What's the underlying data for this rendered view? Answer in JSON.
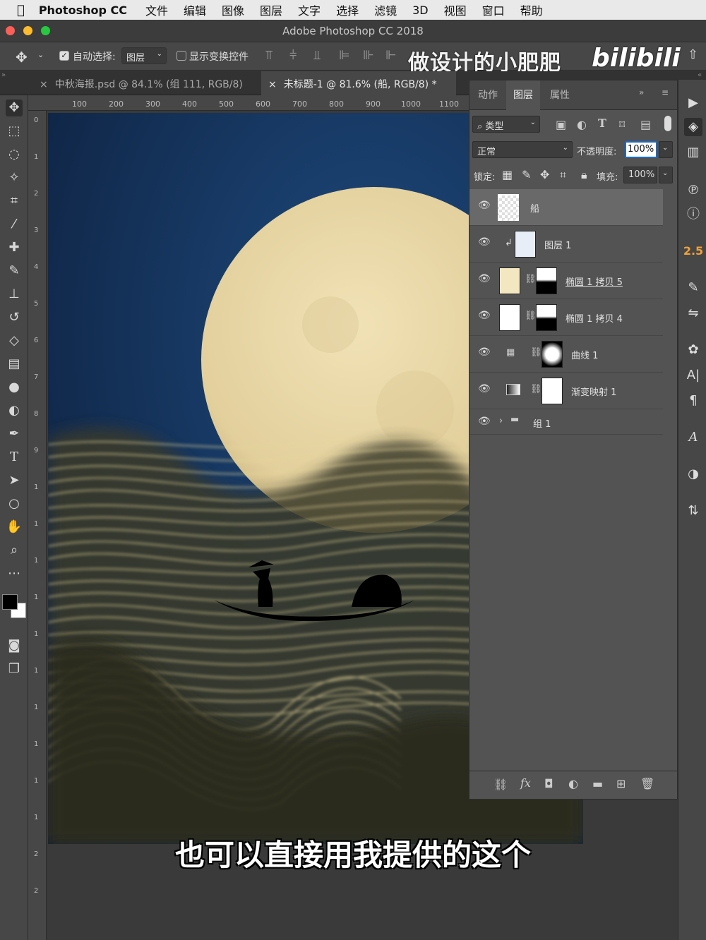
{
  "menubar": {
    "app": "Photoshop CC",
    "items": [
      "文件",
      "编辑",
      "图像",
      "图层",
      "文字",
      "选择",
      "滤镜",
      "3D",
      "视图",
      "窗口",
      "帮助"
    ]
  },
  "titlebar": {
    "title": "Adobe Photoshop CC 2018"
  },
  "options": {
    "auto_select_label": "自动选择:",
    "auto_select_value": "图层",
    "show_transform_label": "显示变换控件"
  },
  "watermark": {
    "text": "做设计的小肥肥",
    "brand": "bilibili"
  },
  "tabs": [
    {
      "label": "中秋海报.psd @ 84.1% (组 111, RGB/8)"
    },
    {
      "label": "未标题-1 @ 81.6% (船, RGB/8) *"
    }
  ],
  "ruler": {
    "top_ticks": [
      "100",
      "200",
      "300",
      "400",
      "500",
      "600",
      "700",
      "800",
      "900",
      "1000",
      "1100"
    ],
    "left_ticks": [
      "0",
      "1",
      "2",
      "3",
      "4",
      "5",
      "6",
      "7",
      "8",
      "9",
      "1",
      "1",
      "1",
      "1",
      "1",
      "1",
      "1",
      "1",
      "1",
      "1",
      "2",
      "2"
    ]
  },
  "panel": {
    "tabs": [
      "动作",
      "图层",
      "属性"
    ],
    "filter_label": "类型",
    "blend_mode": "正常",
    "opacity_label": "不透明度:",
    "opacity_value": "100%",
    "lock_label": "锁定:",
    "fill_label": "填充:",
    "fill_value": "100%",
    "layers": [
      {
        "name": "船"
      },
      {
        "name": "图层 1"
      },
      {
        "name": "椭圆 1 拷贝 5"
      },
      {
        "name": "椭圆 1 拷贝 4"
      },
      {
        "name": "曲线 1"
      },
      {
        "name": "渐变映射 1"
      },
      {
        "name": "组 1"
      }
    ]
  },
  "right_strip": {
    "number": "2.5"
  },
  "subtitle": "也可以直接用我提供的这个",
  "colors": {
    "accent": "#1b6ac9",
    "moon": "#e8d6a6",
    "sky": "#163a66",
    "gold_line": "#e8d79a"
  }
}
